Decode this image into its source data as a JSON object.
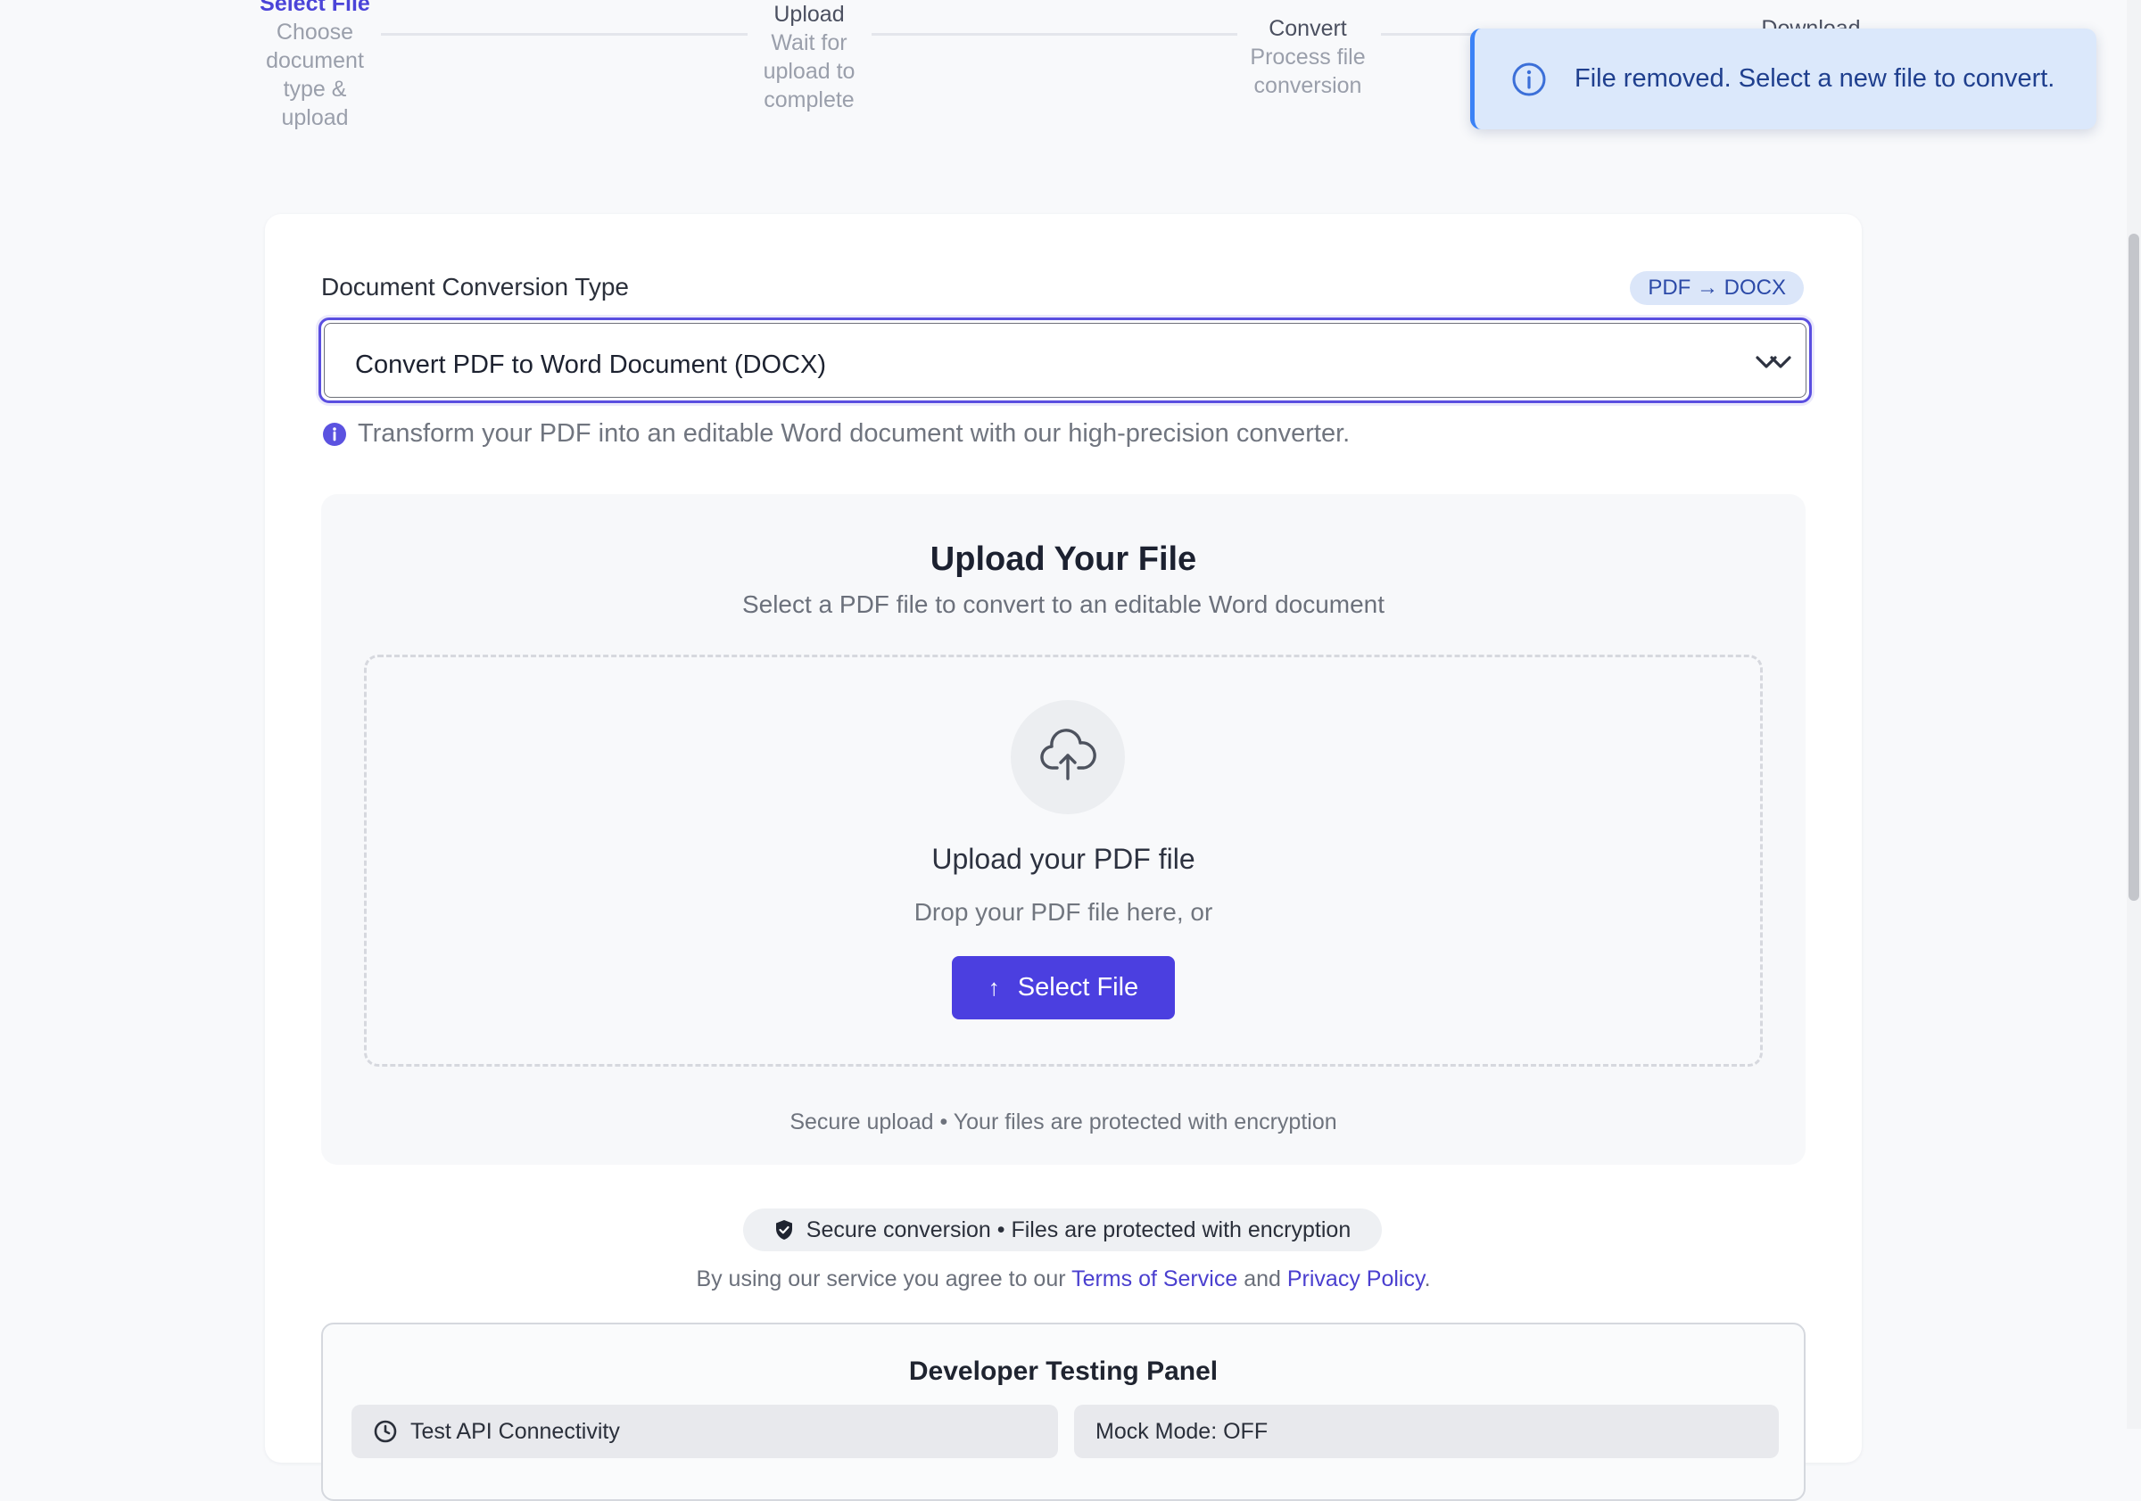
{
  "stepper": {
    "steps": [
      {
        "title": "Select File",
        "description": "Choose document type & upload",
        "state": "active"
      },
      {
        "title": "Upload",
        "description": "Wait for upload to complete",
        "state": "pending"
      },
      {
        "title": "Convert",
        "description": "Process file conversion",
        "state": "pending"
      },
      {
        "title": "Download",
        "description": "",
        "state": "pending"
      }
    ]
  },
  "toast": {
    "message": "File removed. Select a new file to convert.",
    "icon": "info-icon"
  },
  "conversion": {
    "label": "Document Conversion Type",
    "badge": "PDF → DOCX",
    "selected": "Convert PDF to Word Document (DOCX)",
    "hint": "Transform your PDF into an editable Word document with our high-precision converter."
  },
  "upload": {
    "title": "Upload Your File",
    "subtitle": "Select a PDF file to convert to an editable Word document",
    "dropzone_title": "Upload your PDF file",
    "dropzone_sub": "Drop your PDF file here, or",
    "button_label": "Select File",
    "button_icon": "↑",
    "secure_note": "Secure upload • Your files are protected with encryption"
  },
  "footer": {
    "secure_pill": "Secure conversion • Files are protected with encryption",
    "terms_prefix": "By using our service you agree to our",
    "terms_link": "Terms of Service",
    "terms_and": "and",
    "privacy_link": "Privacy Policy",
    "terms_suffix": "."
  },
  "dev_panel": {
    "title": "Developer Testing Panel",
    "test_api_label": "Test API Connectivity",
    "mock_mode_label": "Mock Mode: OFF"
  },
  "colors": {
    "accent": "#4b3fe0",
    "toast_bg": "#dbe8fb",
    "toast_border": "#3b82f6"
  }
}
